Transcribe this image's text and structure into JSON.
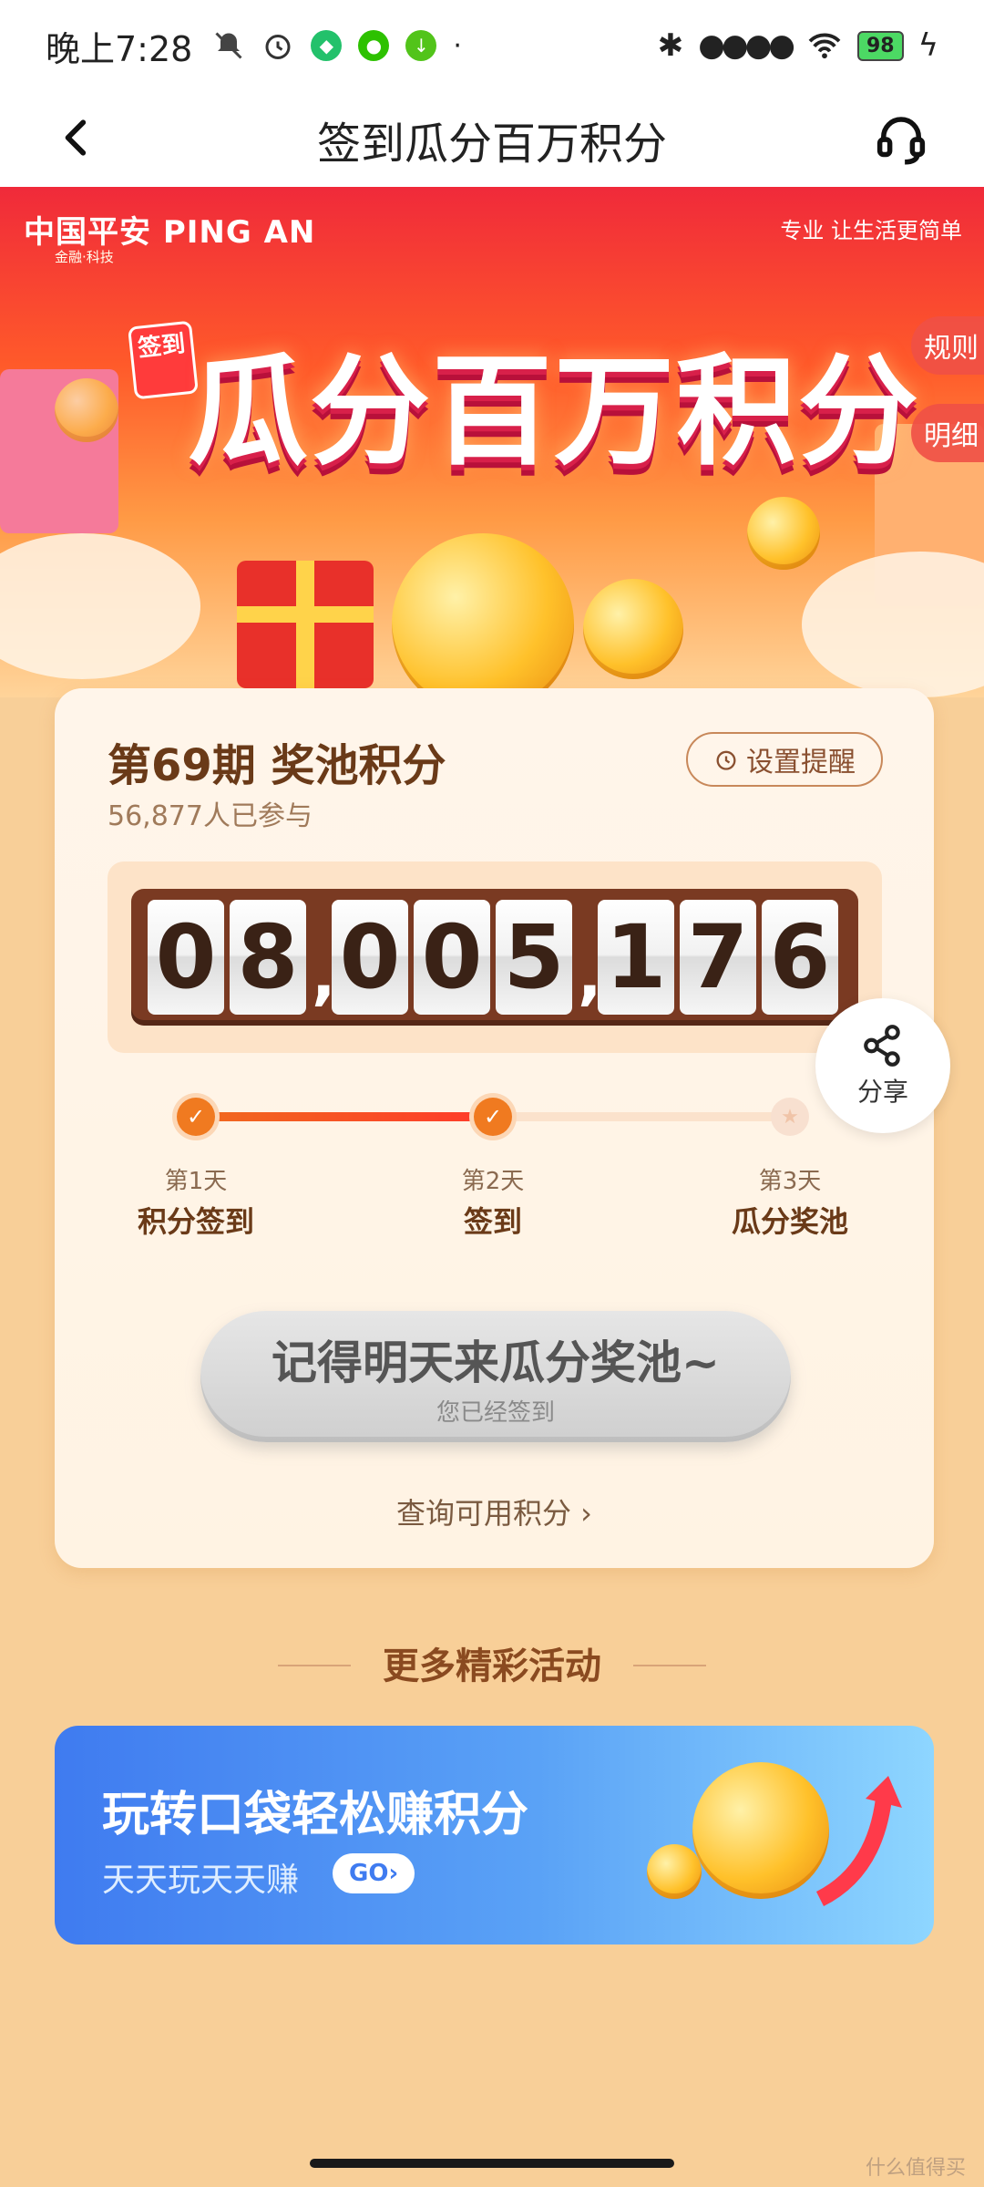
{
  "status_bar": {
    "time": "晚上7:28",
    "battery": "98",
    "icons": [
      "notification-off-icon",
      "alarm-icon",
      "shield-app-icon",
      "wechat-icon",
      "download-icon",
      "bluetooth-icon",
      "signal-icon",
      "wifi-icon",
      "charging-icon"
    ]
  },
  "nav": {
    "title": "签到瓜分百万积分",
    "back_icon": "chevron-left-icon",
    "support_icon": "headset-icon"
  },
  "hero": {
    "brand": "中国平安 PING AN",
    "brand_sub": "金融·科技",
    "slogan": "专业 让生活更简单",
    "title_tag": "签到",
    "title": "瓜分百万积分",
    "side_rules": "规则",
    "side_details": "明细"
  },
  "card": {
    "period": "第69期 奖池积分",
    "joined": "56,877人已参与",
    "remind_label": "设置提醒",
    "pool_digits": [
      "0",
      "8",
      "0",
      "0",
      "5",
      "1",
      "7",
      "6"
    ],
    "share_label": "分享",
    "steps": [
      {
        "day": "第1天",
        "label": "积分签到",
        "done": true
      },
      {
        "day": "第2天",
        "label": "签到",
        "done": true
      },
      {
        "day": "第3天",
        "label": "瓜分奖池",
        "done": false
      }
    ],
    "main_button": "记得明天来瓜分奖池~",
    "main_button_sub": "您已经签到",
    "query_link": "查询可用积分 ›"
  },
  "more": {
    "title": "更多精彩活动",
    "promo_title": "玩转口袋轻松赚积分",
    "promo_sub": "天天玩天天赚",
    "promo_go": "GO›"
  },
  "watermark": "什么值得买",
  "colors": {
    "page_bg": "#f8cf98",
    "accent_orange": "#f07a20",
    "promo_blue": "#3f7bf0"
  }
}
